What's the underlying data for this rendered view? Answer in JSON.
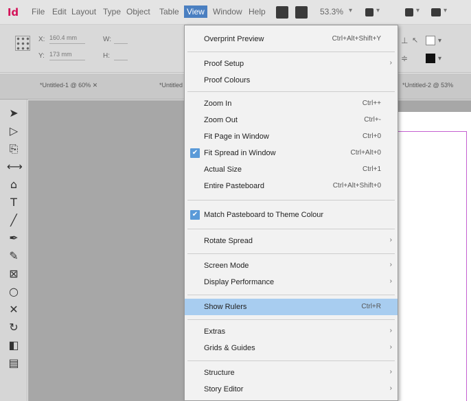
{
  "menubar": {
    "logo": "Id",
    "items": [
      "File",
      "Edit",
      "Layout",
      "Type",
      "Object",
      "Table",
      "View",
      "Window",
      "Help"
    ],
    "zoom": "53.3%"
  },
  "control_panel": {
    "x_label": "X:",
    "y_label": "Y:",
    "x_value": "160.4 mm",
    "y_value": "173 mm",
    "w_label": "W:",
    "h_label": "H:"
  },
  "tabs": {
    "doc1": "*Untitled-1 @ 60% ✕",
    "doc2": "*Untitled",
    "doc3": "*Untitled-2 @ 53%"
  },
  "view_menu": {
    "overprint_preview": {
      "label": "Overprint Preview",
      "shortcut": "Ctrl+Alt+Shift+Y"
    },
    "proof_setup": {
      "label": "Proof Setup"
    },
    "proof_colours": {
      "label": "Proof Colours"
    },
    "zoom_in": {
      "label": "Zoom In",
      "shortcut": "Ctrl++"
    },
    "zoom_out": {
      "label": "Zoom Out",
      "shortcut": "Ctrl+-"
    },
    "fit_page": {
      "label": "Fit Page in Window",
      "shortcut": "Ctrl+0"
    },
    "fit_spread": {
      "label": "Fit Spread in Window",
      "shortcut": "Ctrl+Alt+0"
    },
    "actual_size": {
      "label": "Actual Size",
      "shortcut": "Ctrl+1"
    },
    "entire_pasteboard": {
      "label": "Entire Pasteboard",
      "shortcut": "Ctrl+Alt+Shift+0"
    },
    "match_pasteboard": {
      "label": "Match Pasteboard to Theme Colour"
    },
    "rotate_spread": {
      "label": "Rotate Spread"
    },
    "screen_mode": {
      "label": "Screen Mode"
    },
    "display_performance": {
      "label": "Display Performance"
    },
    "show_rulers": {
      "label": "Show Rulers",
      "shortcut": "Ctrl+R"
    },
    "extras": {
      "label": "Extras"
    },
    "grids_guides": {
      "label": "Grids & Guides"
    },
    "structure": {
      "label": "Structure"
    },
    "story_editor": {
      "label": "Story Editor"
    }
  },
  "glyphs": {
    "check": "✔",
    "arrow": "›"
  },
  "colors": {
    "highlight": "#a8cdf0",
    "check": "#5a9ad8",
    "page_edge": "#c45fd0"
  }
}
